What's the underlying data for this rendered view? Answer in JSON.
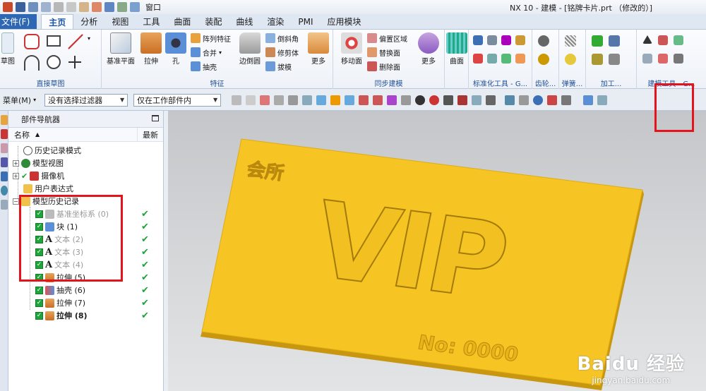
{
  "titlebar": {
    "window_label": "窗口",
    "app_title": "NX 10 - 建模 - [铭牌卡片.prt （修改的）]"
  },
  "tabs": [
    "文件(F)",
    "主页",
    "分析",
    "视图",
    "工具",
    "曲面",
    "装配",
    "曲线",
    "渲染",
    "PMI",
    "应用模块"
  ],
  "ribbon": {
    "groups": {
      "sketch": "直接草图",
      "feature": "特征",
      "sync": "同步建模",
      "standard": "标准化工具 - G...",
      "gear": "齿轮...",
      "spring": "弹簧...",
      "process": "加工...",
      "modeling_tools": "建模工具 - G..."
    },
    "buttons": {
      "sketch": "草图",
      "datum_plane": "基准平面",
      "extrude": "拉伸",
      "hole": "孔",
      "pattern": "阵列特征",
      "unite": "合并",
      "shell": "抽壳",
      "edge_blend": "边倒圆",
      "chamfer": "倒斜角",
      "trim_body": "修剪体",
      "draft": "拔模",
      "more1": "更多",
      "move_face": "移动面",
      "offset_region": "偏置区域",
      "replace_face": "替换面",
      "delete_face": "删除面",
      "more2": "更多",
      "surface": "曲面"
    }
  },
  "selbar": {
    "menu": "菜单(M)",
    "filter": "没有选择过滤器",
    "scope": "仅在工作部件内"
  },
  "navigator": {
    "title": "部件导航器",
    "col_name": "名称",
    "col_latest": "最新",
    "items": [
      {
        "label": "历史记录模式",
        "style": "normal"
      },
      {
        "label": "模型视图",
        "style": "normal"
      },
      {
        "label": "摄像机",
        "style": "normal"
      },
      {
        "label": "用户表达式",
        "style": "normal"
      },
      {
        "label": "模型历史记录",
        "style": "normal"
      },
      {
        "label": "基准坐标系 (0)",
        "style": "dim"
      },
      {
        "label": "块 (1)",
        "style": "normal"
      },
      {
        "label": "文本 (2)",
        "style": "dim"
      },
      {
        "label": "文本 (3)",
        "style": "dim"
      },
      {
        "label": "文本 (4)",
        "style": "dim"
      },
      {
        "label": "拉伸 (5)",
        "style": "normal"
      },
      {
        "label": "抽壳 (6)",
        "style": "normal"
      },
      {
        "label": "拉伸 (7)",
        "style": "normal"
      },
      {
        "label": "拉伸 (8)",
        "style": "bold"
      }
    ]
  },
  "model": {
    "corner_text": "会所",
    "main_text": "VIP",
    "number_text": "No: 0000",
    "card_color": "#f5c21c"
  },
  "watermark": {
    "logo": "Baidu 经验",
    "url": "jingyan.baidu.com"
  },
  "colors": {
    "highlight": "#e3141b",
    "check": "#1ea43a",
    "file_tab": "#2e67b4"
  }
}
